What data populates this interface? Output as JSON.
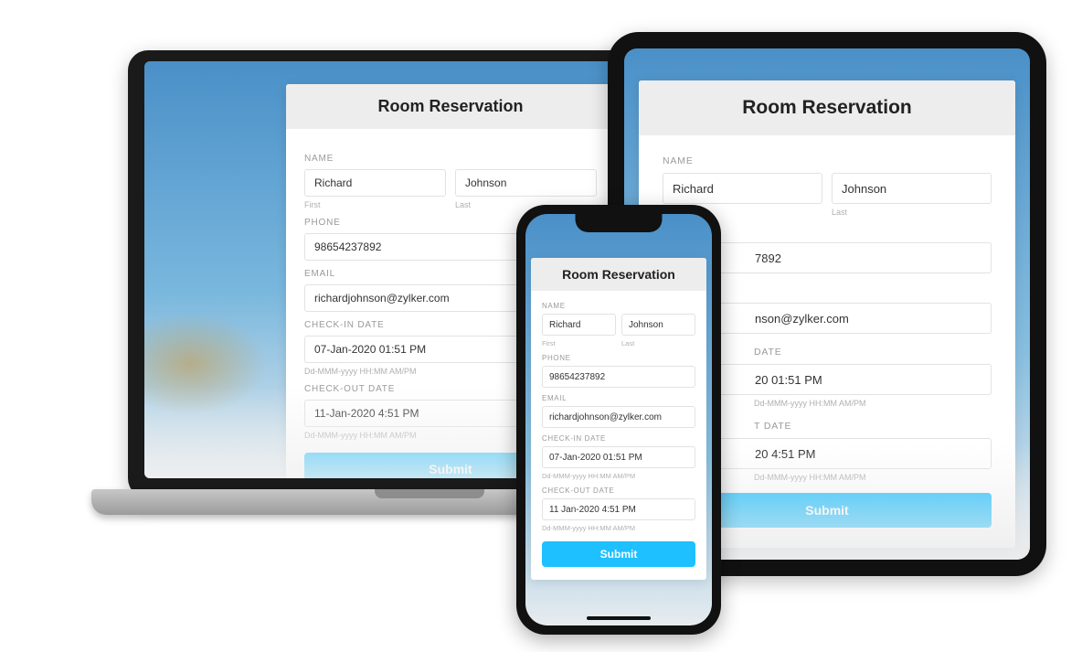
{
  "form": {
    "title": "Room Reservation",
    "labels": {
      "name": "NAME",
      "firstHint": "First",
      "lastHint": "Last",
      "phone": "PHONE",
      "email": "EMAIL",
      "checkin": "CHECK-IN DATE",
      "checkout": "CHECK-OUT DATE",
      "dateHint": "Dd-MMM-yyyy HH:MM AM/PM"
    },
    "values": {
      "firstName": "Richard",
      "lastName": "Johnson",
      "phone": "98654237892",
      "email": "richardjohnson@zylker.com",
      "checkin": "07-Jan-2020 01:51 PM",
      "checkout_laptop": "11-Jan-2020 4:51 PM",
      "checkout_phone": "11 Jan-2020 4:51 PM"
    },
    "submit": "Submit"
  },
  "tablet": {
    "partial": {
      "phoneTail": "7892",
      "emailTail": "nson@zylker.com",
      "checkinLabelTail": "DATE",
      "checkinValueTail": "20 01:51 PM",
      "checkoutLabelTail": "T DATE",
      "checkoutValueTail": "20 4:51 PM"
    }
  }
}
